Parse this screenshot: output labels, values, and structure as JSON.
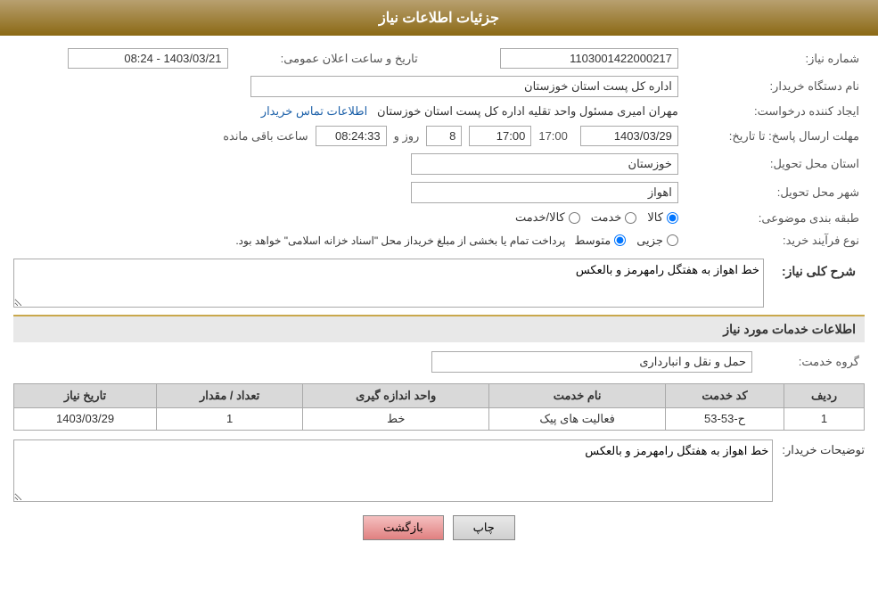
{
  "header": {
    "title": "جزئیات اطلاعات نیاز"
  },
  "fields": {
    "need_number_label": "شماره نیاز:",
    "need_number_value": "1103001422000217",
    "buyer_org_label": "نام دستگاه خریدار:",
    "buyer_org_value": "اداره کل پست استان خوزستان",
    "requester_label": "ایجاد کننده درخواست:",
    "requester_name": "مهران امیری مسئول واحد تقلیه اداره کل پست استان خوزستان",
    "requester_link": "اطلاعات تماس خریدار",
    "deadline_label": "مهلت ارسال پاسخ: تا تاریخ:",
    "announce_label": "تاریخ و ساعت اعلان عمومی:",
    "announce_value": "1403/03/21 - 08:24",
    "deadline_date": "1403/03/29",
    "deadline_time": "17:00",
    "deadline_days": "8",
    "deadline_remaining": "08:24:33",
    "deadline_days_label": "روز و",
    "deadline_remaining_label": "ساعت باقی مانده",
    "province_label": "استان محل تحویل:",
    "province_value": "خوزستان",
    "city_label": "شهر محل تحویل:",
    "city_value": "اهواز",
    "category_label": "طبقه بندی موضوعی:",
    "category_options": [
      "کالا",
      "خدمت",
      "کالا/خدمت"
    ],
    "category_selected": "کالا",
    "process_label": "نوع فرآیند خرید:",
    "process_options": [
      "جزیی",
      "متوسط"
    ],
    "process_selected": "متوسط",
    "process_note": "پرداخت تمام یا بخشی از مبلغ خریداز محل \"اسناد خزانه اسلامی\" خواهد بود.",
    "need_desc_label": "شرح کلی نیاز:",
    "need_desc_value": "خط اهواز به هفتگل رامهرمز و بالعکس"
  },
  "services_section": {
    "title": "اطلاعات خدمات مورد نیاز",
    "service_group_label": "گروه خدمت:",
    "service_group_value": "حمل و نقل و انبارداری",
    "table": {
      "columns": [
        "ردیف",
        "کد خدمت",
        "نام خدمت",
        "واحد اندازه گیری",
        "تعداد / مقدار",
        "تاریخ نیاز"
      ],
      "rows": [
        {
          "index": "1",
          "code": "ح-53-53",
          "name": "فعالیت های پیک",
          "unit": "خط",
          "quantity": "1",
          "date": "1403/03/29"
        }
      ]
    }
  },
  "buyer_description": {
    "label": "توضیحات خریدار:",
    "value": "خط اهواز به هفتگل رامهرمز و بالعکس"
  },
  "buttons": {
    "print": "چاپ",
    "back": "بازگشت"
  }
}
